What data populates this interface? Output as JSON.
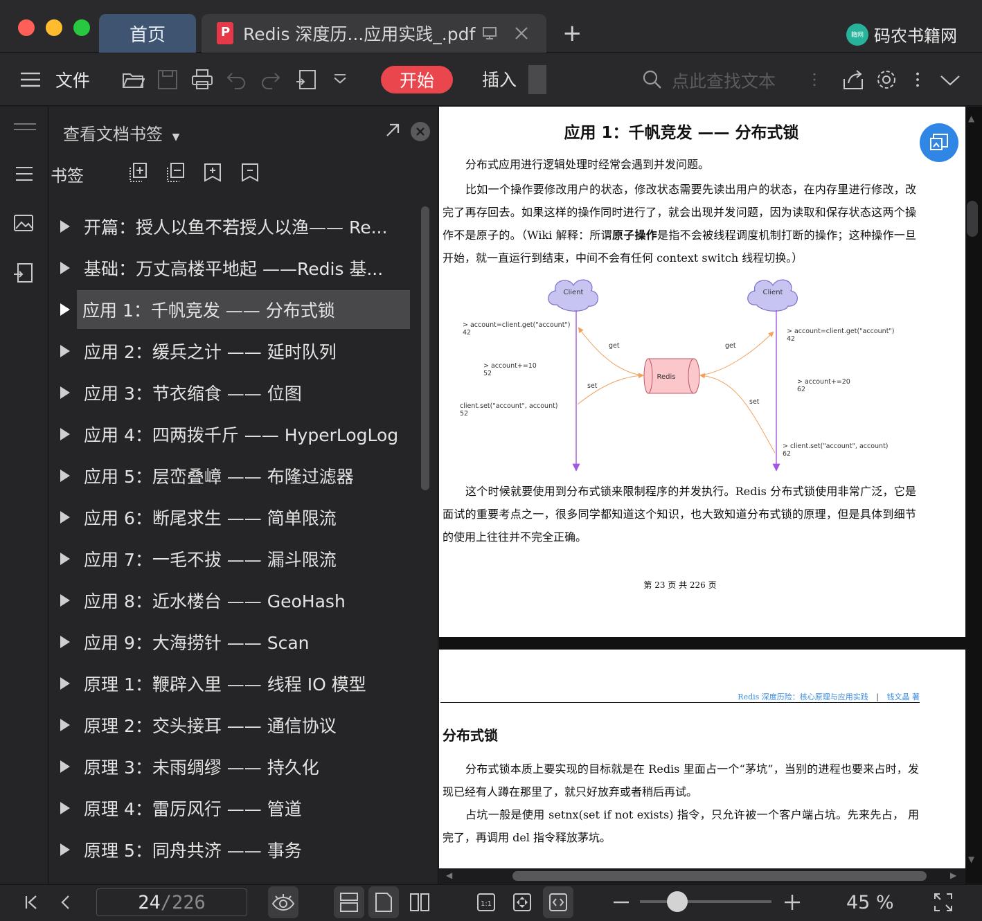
{
  "window": {
    "tabs": [
      {
        "label": "首页",
        "active": false
      },
      {
        "label": "Redis 深度历...应用实践_.pdf",
        "active": true
      }
    ],
    "brand": "码农书籍网",
    "brand_logo_text": "籍网"
  },
  "toolbar": {
    "file_label": "文件",
    "start_label": "开始",
    "insert_label": "插入",
    "search_placeholder": "点此查找文本"
  },
  "sidebar": {
    "title": "查看文档书签",
    "bookmark_label": "书签",
    "items": [
      {
        "label": "开篇：授人以鱼不若授人以渔—— Re..."
      },
      {
        "label": "基础：万丈高楼平地起 ——Redis 基..."
      },
      {
        "label": "应用 1：千帆竞发 —— 分布式锁",
        "selected": true
      },
      {
        "label": "应用 2：缓兵之计 —— 延时队列"
      },
      {
        "label": "应用 3：节衣缩食 —— 位图"
      },
      {
        "label": "应用 4：四两拨千斤 —— HyperLogLog"
      },
      {
        "label": "应用 5：层峦叠嶂 —— 布隆过滤器"
      },
      {
        "label": "应用 6：断尾求生 —— 简单限流"
      },
      {
        "label": "应用 7：一毛不拔 —— 漏斗限流"
      },
      {
        "label": "应用 8：近水楼台 —— GeoHash"
      },
      {
        "label": "应用 9：大海捞针 —— Scan"
      },
      {
        "label": "原理 1：鞭辟入里 —— 线程 IO 模型"
      },
      {
        "label": "原理 2：交头接耳 —— 通信协议"
      },
      {
        "label": "原理 3：未雨绸缪 —— 持久化"
      },
      {
        "label": "原理 4：雷厉风行 —— 管道"
      },
      {
        "label": "原理 5：同舟共济 —— 事务"
      }
    ]
  },
  "page1": {
    "title": "应用 1：千帆竞发 —— 分布式锁",
    "p1": "分布式应用进行逻辑处理时经常会遇到并发问题。",
    "p2": "比如一个操作要修改用户的状态，修改状态需要先读出用户的状态，在内存里进行修改，改完了再存回去。如果这样的操作同时进行了，就会出现并发问题，因为读取和保存状态这两个操作不是原子的。（Wiki 解释：所谓",
    "p2_bold": "原子操作",
    "p2_tail": "是指不会被线程调度机制打断的操作；这种操作一旦开始，就一直运行到结束，中间不会有任何 context switch 线程切换。）",
    "p3": "这个时候就要使用到分布式锁来限制程序的并发执行。Redis 分布式锁使用非常广泛，它是面试的重要考点之一，很多同学都知道这个知识，也大致知道分布式锁的原理，但是具体到细节的使用上往往并不完全正确。",
    "footer": "第 23 页 共 226 页",
    "diagram": {
      "client_left": "Client",
      "client_right": "Client",
      "redis": "Redis",
      "get_left": "get",
      "set_left": "set",
      "get_right": "get",
      "set_right": "set",
      "l1a": "> account=client.get(\"account\")",
      "l1b": "42",
      "l2a": "> account+=10",
      "l2b": "52",
      "l3a": "client.set(\"account\", account)",
      "l3b": "52",
      "r1a": "> account=client.get(\"account\")",
      "r1b": "42",
      "r2a": "> account+=20",
      "r2b": "62",
      "r3a": "> client.set(\"account\", account)",
      "r3b": "62"
    }
  },
  "page2": {
    "header_book": "Redis 深度历险：核心原理与应用实践",
    "header_sep": "|",
    "header_author": "钱文晶 著",
    "section": "分布式锁",
    "p1": "分布式锁本质上要实现的目标就是在 Redis 里面占一个“茅坑”，当别的进程也要来占时，发现已经有人蹲在那里了，就只好放弃或者稍后再试。",
    "p2": "占坑一般是使用 setnx(set if not exists) 指令，只允许被一个客户端占坑。先来先占， 用完了，再调用 del 指令释放茅坑。"
  },
  "status": {
    "page_current": "24",
    "page_total": "/226",
    "zoom": "45 %",
    "zoom_fraction": 0.3
  },
  "colors": {
    "accent": "#e9474d",
    "tab_active": "#3f5470",
    "link_blue": "#3b8de0",
    "float_button": "#2f86e5"
  }
}
